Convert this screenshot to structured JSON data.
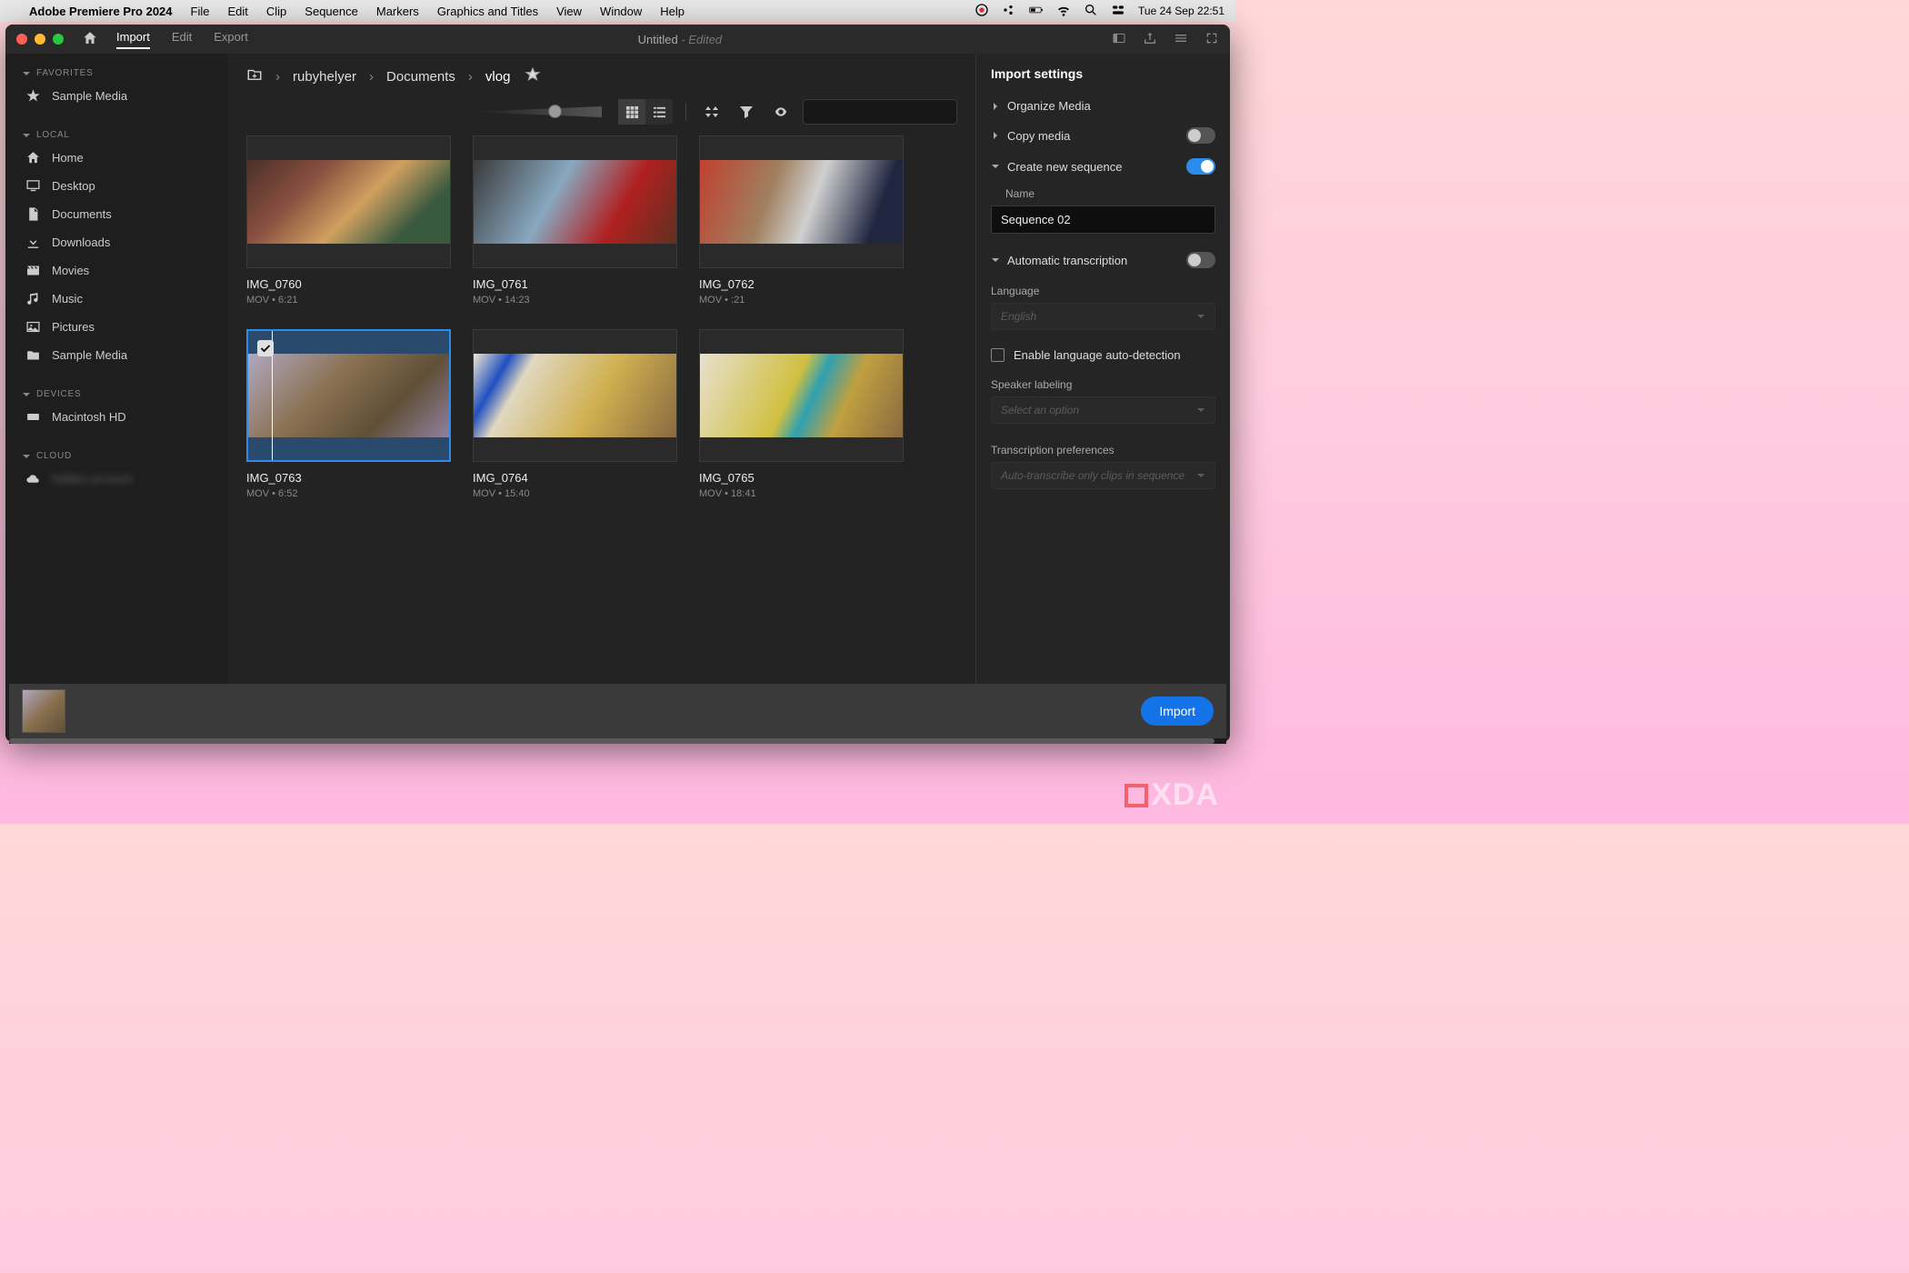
{
  "mac_menubar": {
    "app_name": "Adobe Premiere Pro 2024",
    "menus": [
      "File",
      "Edit",
      "Clip",
      "Sequence",
      "Markers",
      "Graphics and Titles",
      "View",
      "Window",
      "Help"
    ],
    "datetime": "Tue 24 Sep  22:51"
  },
  "titlebar": {
    "tabs": {
      "import": "Import",
      "edit": "Edit",
      "export": "Export"
    },
    "document_title": "Untitled",
    "edited_suffix": " - Edited"
  },
  "sidebar": {
    "favorites_header": "FAVORITES",
    "favorites": [
      {
        "label": "Sample Media",
        "icon": "star"
      }
    ],
    "local_header": "LOCAL",
    "local": [
      {
        "label": "Home",
        "icon": "home"
      },
      {
        "label": "Desktop",
        "icon": "desktop"
      },
      {
        "label": "Documents",
        "icon": "document"
      },
      {
        "label": "Downloads",
        "icon": "download"
      },
      {
        "label": "Movies",
        "icon": "movie"
      },
      {
        "label": "Music",
        "icon": "music"
      },
      {
        "label": "Pictures",
        "icon": "picture"
      },
      {
        "label": "Sample Media",
        "icon": "folder"
      }
    ],
    "devices_header": "DEVICES",
    "devices": [
      {
        "label": "Macintosh HD",
        "icon": "drive"
      }
    ],
    "cloud_header": "CLOUD",
    "cloud": [
      {
        "label": "hidden account",
        "icon": "cloud"
      }
    ]
  },
  "breadcrumb": [
    "rubyhelyer",
    "Documents",
    "vlog"
  ],
  "search_placeholder": "",
  "clips": [
    {
      "name": "IMG_0760",
      "format": "MOV",
      "duration": "6:21",
      "selected": false
    },
    {
      "name": "IMG_0761",
      "format": "MOV",
      "duration": "14:23",
      "selected": false
    },
    {
      "name": "IMG_0762",
      "format": "MOV",
      "duration": ":21",
      "selected": false
    },
    {
      "name": "IMG_0763",
      "format": "MOV",
      "duration": "6:52",
      "selected": true
    },
    {
      "name": "IMG_0764",
      "format": "MOV",
      "duration": "15:40",
      "selected": false
    },
    {
      "name": "IMG_0765",
      "format": "MOV",
      "duration": "18:41",
      "selected": false
    }
  ],
  "settings": {
    "title": "Import settings",
    "organize_media": "Organize Media",
    "copy_media": "Copy media",
    "copy_media_on": false,
    "create_sequence": "Create new sequence",
    "create_sequence_on": true,
    "name_label": "Name",
    "sequence_name": "Sequence 02",
    "auto_transcription": "Automatic transcription",
    "auto_transcription_on": false,
    "language_label": "Language",
    "language_value": "English",
    "auto_detect": "Enable language auto-detection",
    "speaker_label": "Speaker labeling",
    "speaker_placeholder": "Select an option",
    "transcription_prefs": "Transcription preferences",
    "transcription_prefs_value": "Auto-transcribe only clips in sequence"
  },
  "import_button": "Import",
  "watermark": "XDA"
}
